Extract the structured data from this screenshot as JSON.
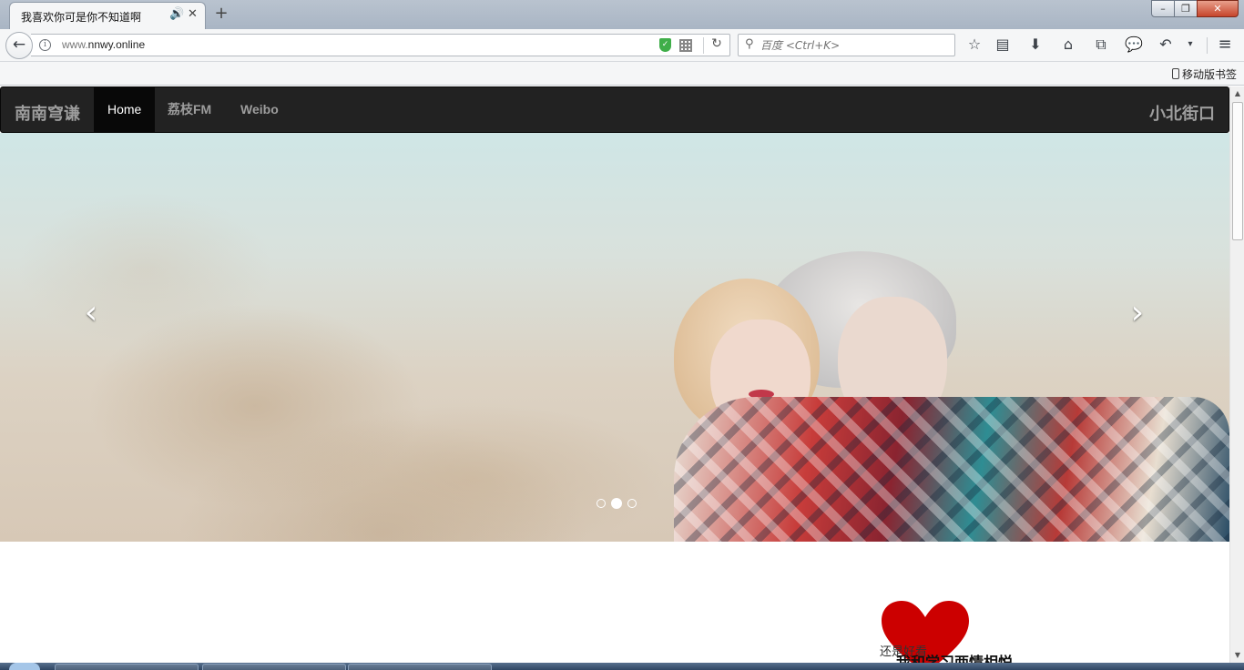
{
  "browser": {
    "tab_title": "我喜欢你可是你不知道啊",
    "url_prefix": "www.",
    "url_domain": "nnwy.online",
    "search_placeholder": "百度 <Ctrl+K>",
    "bookmark_mobile": "移动版书签"
  },
  "site": {
    "brand": "南南穹谦",
    "nav": [
      "Home",
      "荔枝FM",
      "Weibo"
    ],
    "brand_right": "小北街口",
    "carousel": {
      "prev_glyph": "‹",
      "next_glyph": "›",
      "slide_count": 3,
      "active_slide": 2
    },
    "caption_small": "还是好看",
    "caption_large": "我和学习两情相悦"
  },
  "colors": {
    "navbar_bg": "#222222",
    "navbar_active": "#080808",
    "heart": "#cc0000"
  }
}
